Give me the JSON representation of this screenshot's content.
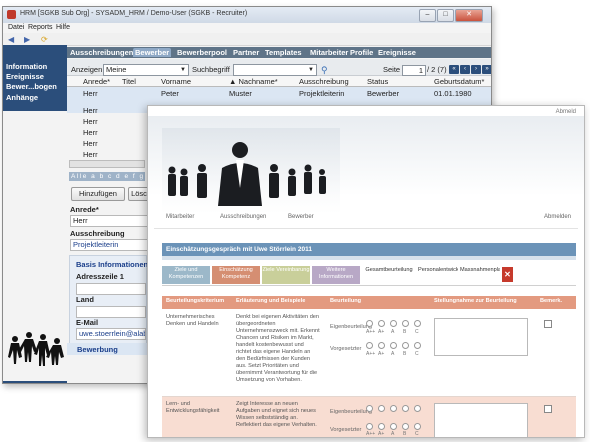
{
  "app_window": {
    "title": "HRM [SGKB Sub Org] - SYSADM_HRM / Demo-User (SGKB - Recruiter)",
    "menu": [
      "Datei",
      "Reports",
      "Hilfe"
    ],
    "window_buttons": {
      "minimize": "–",
      "maximize": "□",
      "close": "✕"
    },
    "toolbar_icons": [
      "back-icon",
      "forward-icon",
      "refresh-icon"
    ],
    "sidebar": [
      "Information",
      "Ereignisse",
      "Bewer...bogen",
      "Anhänge"
    ],
    "tabs": [
      "Ausschreibungen",
      "Bewerber",
      "Bewerberpool",
      "Partner",
      "Templates",
      "Mitarbeiter",
      "Profile",
      "Ereignisse"
    ],
    "filter": {
      "anzeigen_label": "Anzeigen",
      "anzeigen_value": "Meine",
      "suchbegriff_label": "Suchbegriff",
      "seite_label": "Seite",
      "page_value": "1",
      "page_total": "/ 2 (7)",
      "nav": [
        "«",
        "‹",
        "›",
        "»"
      ]
    },
    "table": {
      "columns": [
        "Anrede*",
        "Titel",
        "Vorname",
        "▲ Nachname*",
        "Ausschreibung",
        "Status",
        "Geburtsdatum*"
      ],
      "first_row": [
        "Herr",
        "",
        "Peter",
        "Muster",
        "Projektleiterin",
        "Bewerber",
        "01.01.1980"
      ],
      "more_anrede": [
        "Herr",
        "Herr",
        "Herr",
        "Herr",
        "Herr"
      ]
    },
    "alphabet": "Alle a b c d e f g",
    "buttons": {
      "add": "Hinzufügen",
      "delete": "Lösc"
    },
    "form": {
      "anrede_label": "Anrede*",
      "anrede_value": "Herr",
      "ausschreibung_label": "Ausschreibung",
      "ausschreibung_value": "Projektleiterin",
      "basis_title": "Basis Informationen",
      "adress_label": "Adresszeile 1",
      "land_label": "Land",
      "email_label": "E-Mail",
      "email_value": "uwe.stoerrlein@alab",
      "bewerbung_label": "Bewerbung"
    }
  },
  "web_window": {
    "user_link": "Abmeld",
    "nav": [
      "Mitarbeiter",
      "Ausschreibungen",
      "Bewerber",
      "Abmelden"
    ],
    "section_title": "Einschätzungsgespräch mit Uwe Störrlein 2011",
    "steps": [
      "Ziele und Kompetenzen",
      "Einschätzung Kompetenz",
      "Ziele Vereinbarung",
      "Weitere Informationen",
      "Gesamtbeurteilung",
      "Personalentwicklung",
      "Massnahmenplanung"
    ],
    "step_colors": [
      "#9cb8c9",
      "#d58e72",
      "#c9cf9a",
      "#b8a8c6"
    ],
    "question_header": [
      "Beurteilungskriterium",
      "Erläuterung und Beispiele",
      "Beurteilung",
      "Stellungnahme zur Beurteilung",
      "Bemerk."
    ],
    "rows": [
      {
        "criterion": "Unternehmerisches Denken und Handeln",
        "description": "Denkt bei eigenen Aktivitäten den übergeordneten Unternehmenszweck mit. Erkennt Chancen und Risiken im Markt, handelt kostenbewusst und richtet das eigene Handeln an den Bedürfnissen der Kunden aus. Setzt Prioritäten und übernimmt Verantwortung für die Umsetzung von Vorhaben.",
        "label_a": "Eigenbeurteilung",
        "label_b": "Vorgesetzter"
      },
      {
        "criterion": "Lern- und Entwicklungsfähigkeit",
        "description": "Zeigt Interesse an neuen Aufgaben und eignet sich neues Wissen selbstständig an. Reflektiert das eigene Verhalten.",
        "label_a": "Eigenbeurteilung",
        "label_b": "Vorgesetzter"
      }
    ],
    "scale": [
      "A++",
      "A+",
      "A",
      "B",
      "C"
    ],
    "colors": {
      "section": "#6b93b8",
      "header": "#e39a80",
      "row_alt": "#f8ddd2",
      "alert": "#c63a2c"
    }
  }
}
